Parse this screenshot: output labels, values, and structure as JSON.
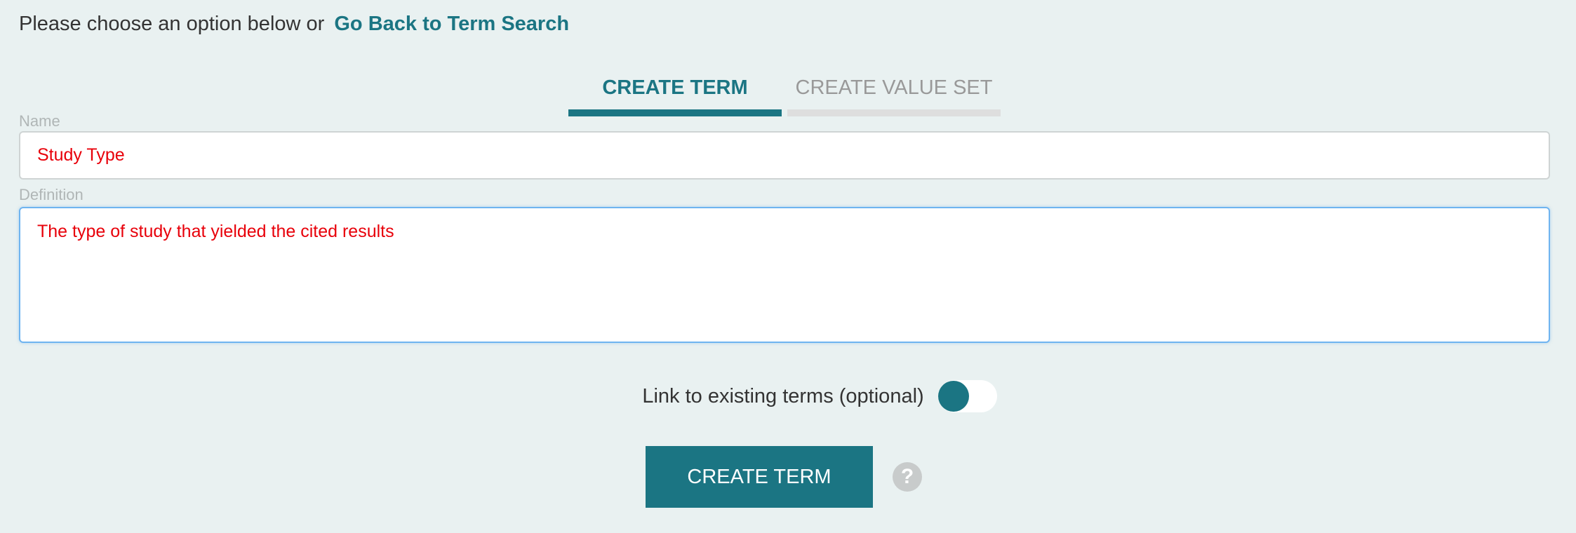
{
  "header": {
    "prompt": "Please choose an option below or",
    "back_link": "Go Back to Term Search"
  },
  "tabs": [
    {
      "label": "CREATE TERM",
      "active": true
    },
    {
      "label": "CREATE VALUE SET",
      "active": false
    }
  ],
  "form": {
    "name_label": "Name",
    "name_value": "Study Type",
    "definition_label": "Definition",
    "definition_value": "The type of study that yielded the cited results",
    "link_label": "Link to existing terms (optional)",
    "link_enabled": false,
    "submit_label": "CREATE TERM",
    "help_icon": "question-mark-icon"
  },
  "colors": {
    "accent": "#1b7583",
    "input_text": "#e8000a",
    "background": "#e9f1f1"
  }
}
